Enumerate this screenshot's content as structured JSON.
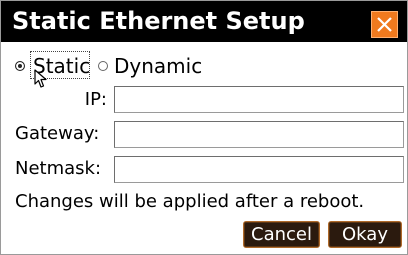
{
  "dialog": {
    "title": "Static Ethernet Setup",
    "close_icon": "close-icon",
    "accent_color": "#f07a1e"
  },
  "mode": {
    "options": [
      {
        "label": "Static",
        "checked": true
      },
      {
        "label": "Dynamic",
        "checked": false
      }
    ],
    "selected": "Static"
  },
  "fields": {
    "ip": {
      "label": "IP:",
      "value": ""
    },
    "gateway": {
      "label": "Gateway:",
      "value": ""
    },
    "netmask": {
      "label": "Netmask:",
      "value": ""
    }
  },
  "notice": "Changes will be applied after a reboot.",
  "buttons": {
    "cancel": "Cancel",
    "okay": "Okay"
  }
}
